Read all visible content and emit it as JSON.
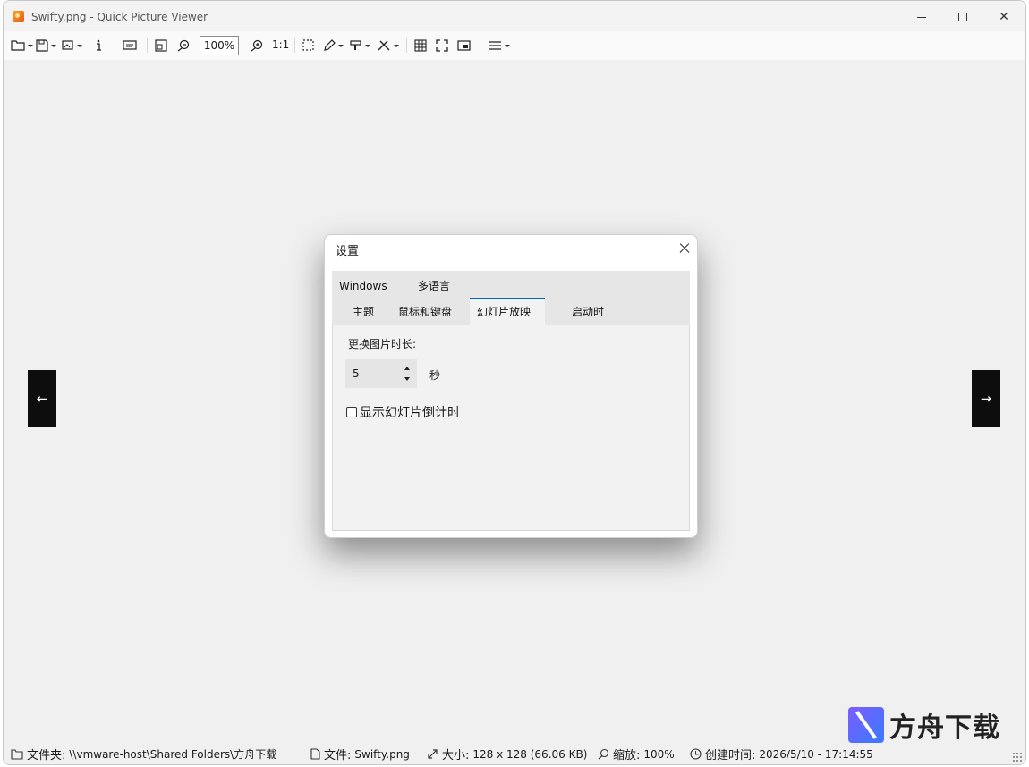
{
  "window": {
    "title": "Swifty.png - Quick Picture Viewer"
  },
  "toolbar": {
    "zoom_value": "100%",
    "actual_size_label": "1:1"
  },
  "navigation": {
    "prev_glyph": "←",
    "next_glyph": "→"
  },
  "dialog": {
    "title": "设置",
    "tabs_row1": [
      "Windows",
      "多语言"
    ],
    "tabs_row2": [
      "主题",
      "鼠标和键盘",
      "幻灯片放映",
      "启动时"
    ],
    "active_tab": "幻灯片放映",
    "duration_label": "更换图片时长:",
    "duration_value": "5",
    "seconds_unit": "秒",
    "countdown_checkbox_label": "显示幻灯片倒计时",
    "countdown_checked": false
  },
  "statusbar": {
    "folder_label": "文件夹:",
    "folder_value": "\\\\vmware-host\\Shared Folders\\方舟下载",
    "file_label": "文件:",
    "file_value": "Swifty.png",
    "size_label": "大小:",
    "size_value": "128 x 128 (66.06 KB)",
    "zoom_label": "缩放:",
    "zoom_value": "100%",
    "created_label": "创建时间:",
    "created_value": "2026/5/10 - 17:14:55"
  },
  "watermark": {
    "text": "方舟下载"
  },
  "icons": [
    "open-folder-icon",
    "save-icon",
    "wallpaper-icon",
    "info-icon",
    "slideshow-icon",
    "fit-icon",
    "zoom-out-icon",
    "zoom-in-icon",
    "select-icon",
    "pen-icon",
    "paint-icon",
    "tools-icon",
    "grid-icon",
    "fullscreen-icon",
    "picture-in-picture-icon",
    "menu-icon"
  ],
  "colors": {
    "accent": "#0067c0",
    "nav_bg": "#0d0d0d"
  }
}
